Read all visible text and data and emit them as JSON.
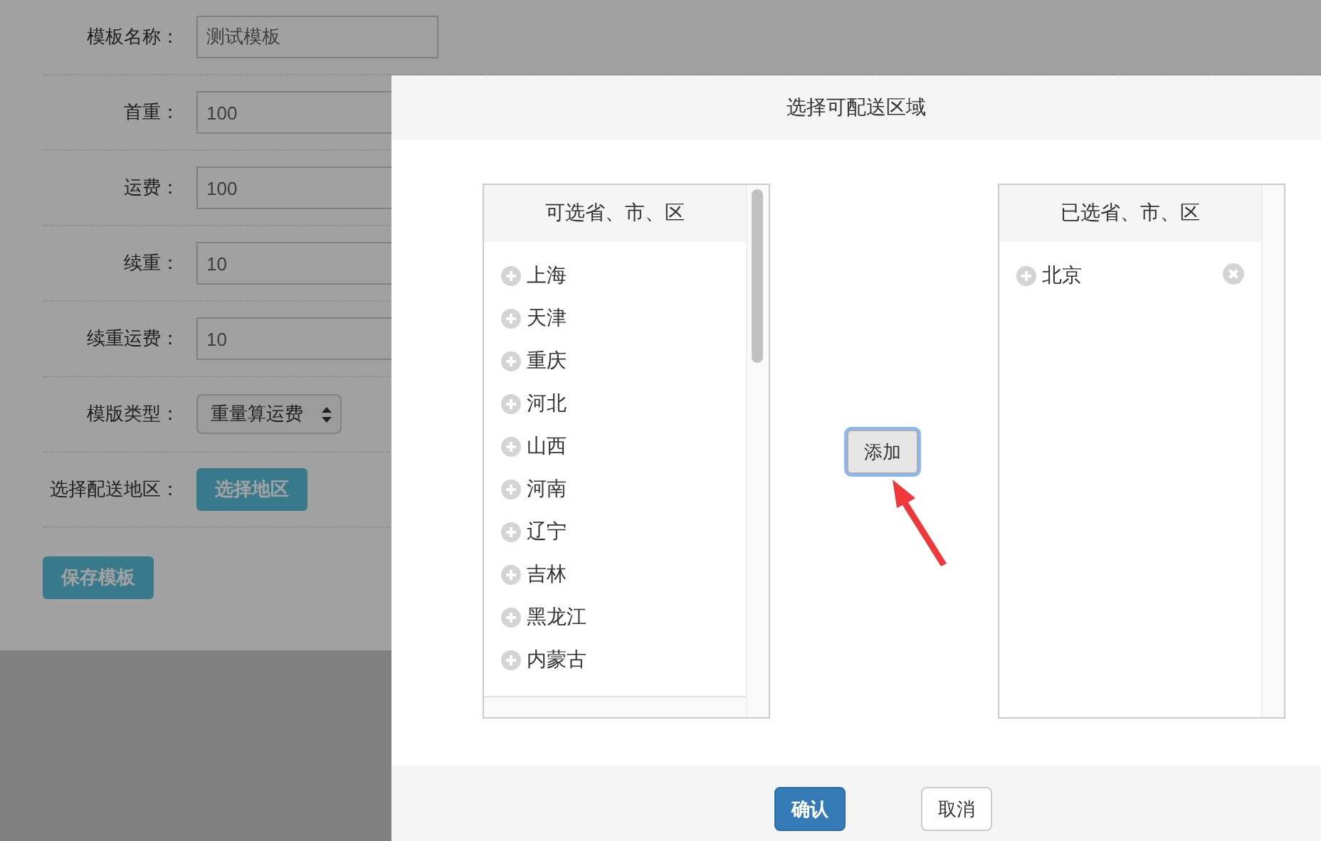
{
  "form": {
    "fields": [
      {
        "kind": "input",
        "label": "模板名称：",
        "value": "测试模板"
      },
      {
        "kind": "input",
        "label": "首重：",
        "value": "100"
      },
      {
        "kind": "input",
        "label": "运费：",
        "value": "100"
      },
      {
        "kind": "input",
        "label": "续重：",
        "value": "10"
      },
      {
        "kind": "input",
        "label": "续重运费：",
        "value": "10"
      },
      {
        "kind": "select",
        "label": "模版类型：",
        "value": "重量算运费"
      },
      {
        "kind": "button",
        "label": "选择配送地区：",
        "value": "选择地区"
      }
    ],
    "save_button": "保存模板"
  },
  "dialog": {
    "title": "选择可配送区域",
    "available": {
      "title": "可选省、市、区",
      "items": [
        "上海",
        "天津",
        "重庆",
        "河北",
        "山西",
        "河南",
        "辽宁",
        "吉林",
        "黑龙江",
        "内蒙古"
      ]
    },
    "add_button": "添加",
    "selected": {
      "title": "已选省、市、区",
      "items": [
        "北京"
      ]
    },
    "buttons": [
      {
        "label": "确认",
        "kind": "primary"
      },
      {
        "label": "取消",
        "kind": "default"
      }
    ]
  }
}
